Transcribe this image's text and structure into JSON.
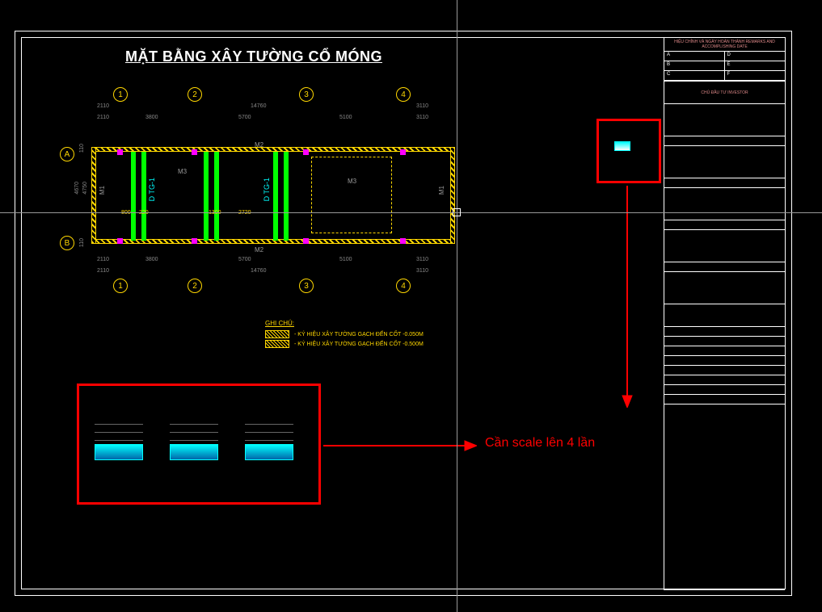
{
  "drawing": {
    "title": "MẶT BẰNG XÂY TƯỜNG CỔ MÓNG",
    "grid_columns": [
      "1",
      "2",
      "3",
      "4"
    ],
    "grid_rows": [
      "A",
      "B"
    ],
    "dims_top_outer": [
      "2110",
      "14760",
      "3110"
    ],
    "dims_top_inner": [
      "2110",
      "3800",
      "5700",
      "5100",
      "3110"
    ],
    "dims_bottom_outer": [
      "2110",
      "14760",
      "3110"
    ],
    "dims_bottom_inner": [
      "2110",
      "3800",
      "5700",
      "5100",
      "3110"
    ],
    "dims_left": [
      "110",
      "4670",
      "4750",
      "110"
    ],
    "wall_labels": {
      "m1_left": "M1",
      "m1_right": "M1",
      "m2_top": "M2",
      "m2_bot": "M2",
      "m3_a": "M3",
      "m3_b": "M3"
    },
    "tie_labels": [
      "D TG-1",
      "D TG-1"
    ],
    "dims_small": [
      "800",
      "220",
      "1300",
      "2720"
    ]
  },
  "legend": {
    "title": "GHI CHÚ:",
    "item1": "- KÝ HIỆU XÂY TƯỜNG GẠCH ĐẾN CỐT -0.050M",
    "item2": "- KÝ HIỆU XÂY TƯỜNG GẠCH ĐẾN CỐT -0.500M"
  },
  "annotation": {
    "scale_note": "Cần scale lên 4 lần"
  },
  "titleblock": {
    "header": "HIỆU CHỈNH VÀ NGÀY HOÀN THÀNH\nREMARKS AND ACCOMPLISHING DATE",
    "rows": [
      "A",
      "D",
      "B",
      "E",
      "C",
      "F"
    ],
    "investor_label": "CHỦ ĐẦU TƯ\nINVESTOR"
  }
}
